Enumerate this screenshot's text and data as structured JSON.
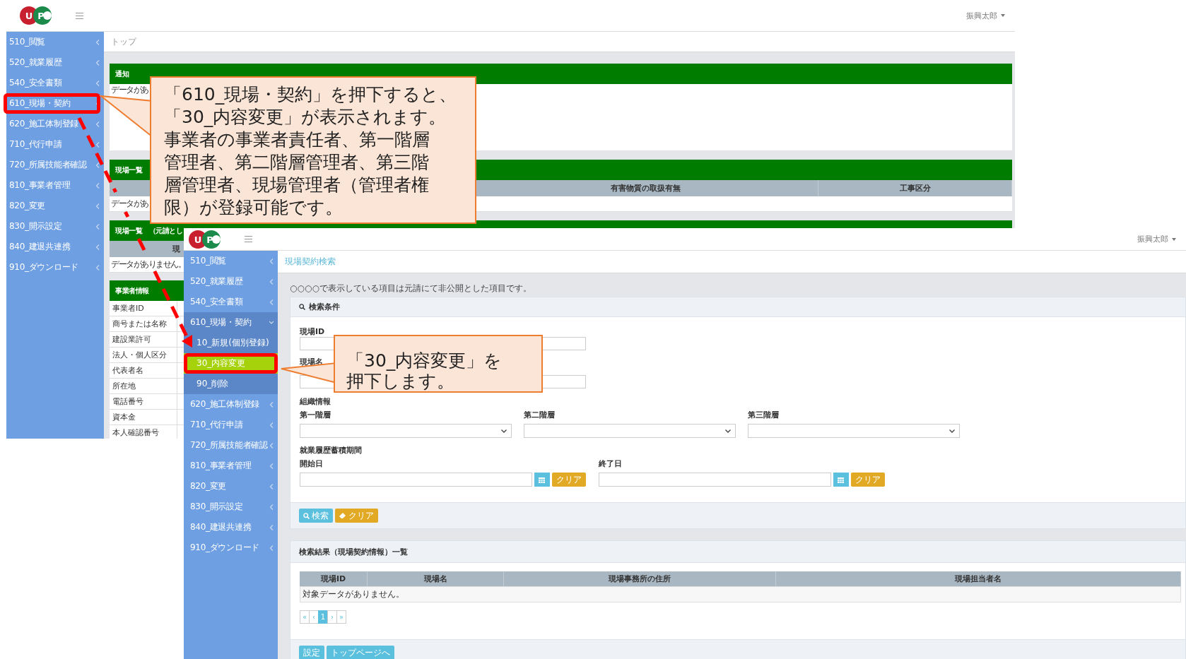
{
  "background_screen": {
    "logo": [
      "U",
      "P"
    ],
    "user_menu": "振興太郎",
    "sidebar": {
      "items": [
        {
          "label": "510_閲覧"
        },
        {
          "label": "520_就業履歴"
        },
        {
          "label": "540_安全書類"
        },
        {
          "label": "610_現場・契約"
        },
        {
          "label": "620_施工体制登録"
        },
        {
          "label": "710_代行申請"
        },
        {
          "label": "720_所属技能者確認"
        },
        {
          "label": "810_事業者管理"
        },
        {
          "label": "820_変更"
        },
        {
          "label": "830_開示設定"
        },
        {
          "label": "840_建退共連携"
        },
        {
          "label": "910_ダウンロード"
        }
      ]
    },
    "breadcrumb": "トップ",
    "notice_panel": {
      "title": "通知",
      "message": "データがあ"
    },
    "sites_panel": {
      "title": "現場一覧",
      "columns": [
        "有害物質の取扱有無",
        "工事区分"
      ],
      "row_text": "データがあ"
    },
    "prime_sites_panel": {
      "title": "現場一覧　（元請とし",
      "column_1": "現",
      "row_text": "データがありません。"
    },
    "company_panel": {
      "title": "事業者情報",
      "rows": [
        "事業者ID",
        "商号または名称",
        "建設業許可",
        "法人・個人区分",
        "代表者名",
        "所在地",
        "電話番号",
        "資本金",
        "本人確認番号"
      ]
    }
  },
  "foreground_screen": {
    "logo": [
      "U",
      "P"
    ],
    "user_menu": "振興太郎",
    "sidebar": {
      "items": [
        {
          "label": "510_閲覧",
          "expanded": false
        },
        {
          "label": "520_就業履歴",
          "expanded": false
        },
        {
          "label": "540_安全書類",
          "expanded": false
        },
        {
          "label": "610_現場・契約",
          "expanded": true,
          "children": [
            {
              "label": "10_新規(個別登録)",
              "selected": false
            },
            {
              "label": "30_内容変更",
              "selected": true
            },
            {
              "label": "90_削除",
              "selected": false
            }
          ]
        },
        {
          "label": "620_施工体制登録",
          "expanded": false
        },
        {
          "label": "710_代行申請",
          "expanded": false
        },
        {
          "label": "720_所属技能者確認",
          "expanded": false
        },
        {
          "label": "810_事業者管理",
          "expanded": false
        },
        {
          "label": "820_変更",
          "expanded": false
        },
        {
          "label": "830_開示設定",
          "expanded": false
        },
        {
          "label": "840_建退共連携",
          "expanded": false
        },
        {
          "label": "910_ダウンロード",
          "expanded": false
        }
      ]
    },
    "breadcrumb": "現場契約検索",
    "notice": "○○○○で表示している項目は元請にて非公開とした項目です。",
    "search_panel": {
      "title": "検索条件",
      "fields": [
        "現場ID",
        "現場名"
      ],
      "org_section": "組織情報",
      "selects": [
        "第一階層",
        "第二階層",
        "第三階層"
      ],
      "period_section": "就業履歴蓄積期間",
      "dates": [
        {
          "label": "開始日",
          "clear": "クリア"
        },
        {
          "label": "終了日",
          "clear": "クリア"
        }
      ],
      "buttons": [
        {
          "label": "検索",
          "kind": "search"
        },
        {
          "label": "クリア",
          "kind": "clear"
        }
      ]
    },
    "results_panel": {
      "title": "検索結果（現場契約情報）一覧",
      "columns": [
        "現場ID",
        "現場名",
        "現場事務所の住所",
        "現場担当者名"
      ],
      "empty_text": "対象データがありません。",
      "pagination": [
        {
          "label": "«",
          "selected": false
        },
        {
          "label": "‹",
          "selected": false
        },
        {
          "label": "1",
          "selected": true
        },
        {
          "label": "›",
          "selected": false
        },
        {
          "label": "»",
          "selected": false
        }
      ]
    },
    "footer_buttons": [
      "設定",
      "トップページへ"
    ]
  },
  "callouts": [
    {
      "lines": [
        "「610_現場・契約」を押下すると、",
        "「30_内容変更」が表示されます。",
        "事業者の事業者責任者、第一階層",
        "管理者、第二階層管理者、第三階",
        "層管理者、現場管理者（管理者権",
        "限）が登録可能です。"
      ]
    },
    {
      "lines": [
        "「30_内容変更」を",
        "押下します。"
      ]
    }
  ]
}
